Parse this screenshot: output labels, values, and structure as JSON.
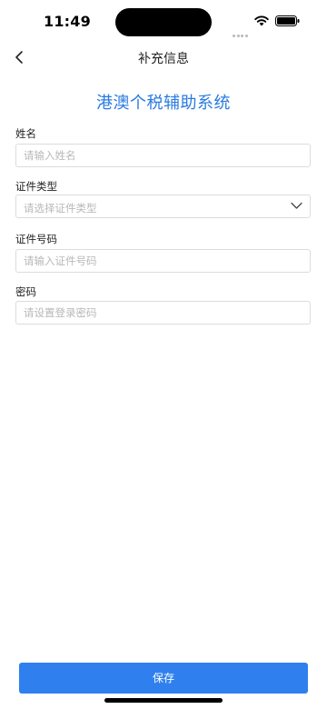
{
  "status_bar": {
    "time": "11:49",
    "signal_icon": "cellular-dots-icon",
    "wifi_icon": "wifi-icon",
    "battery_icon": "battery-icon"
  },
  "nav": {
    "back_icon": "chevron-left-icon",
    "title": "补充信息"
  },
  "system_title": "港澳个税辅助系统",
  "colors": {
    "accent": "#2a7be0",
    "button": "#2f80ee",
    "border": "#dcdcdc",
    "placeholder": "#b8b8b8"
  },
  "form": {
    "name": {
      "label": "姓名",
      "placeholder": "请输入姓名",
      "value": ""
    },
    "id_type": {
      "label": "证件类型",
      "placeholder": "请选择证件类型",
      "icon": "chevron-down-icon"
    },
    "id_number": {
      "label": "证件号码",
      "placeholder": "请输入证件号码",
      "value": ""
    },
    "password": {
      "label": "密码",
      "placeholder": "请设置登录密码",
      "value": ""
    }
  },
  "actions": {
    "save_label": "保存"
  }
}
